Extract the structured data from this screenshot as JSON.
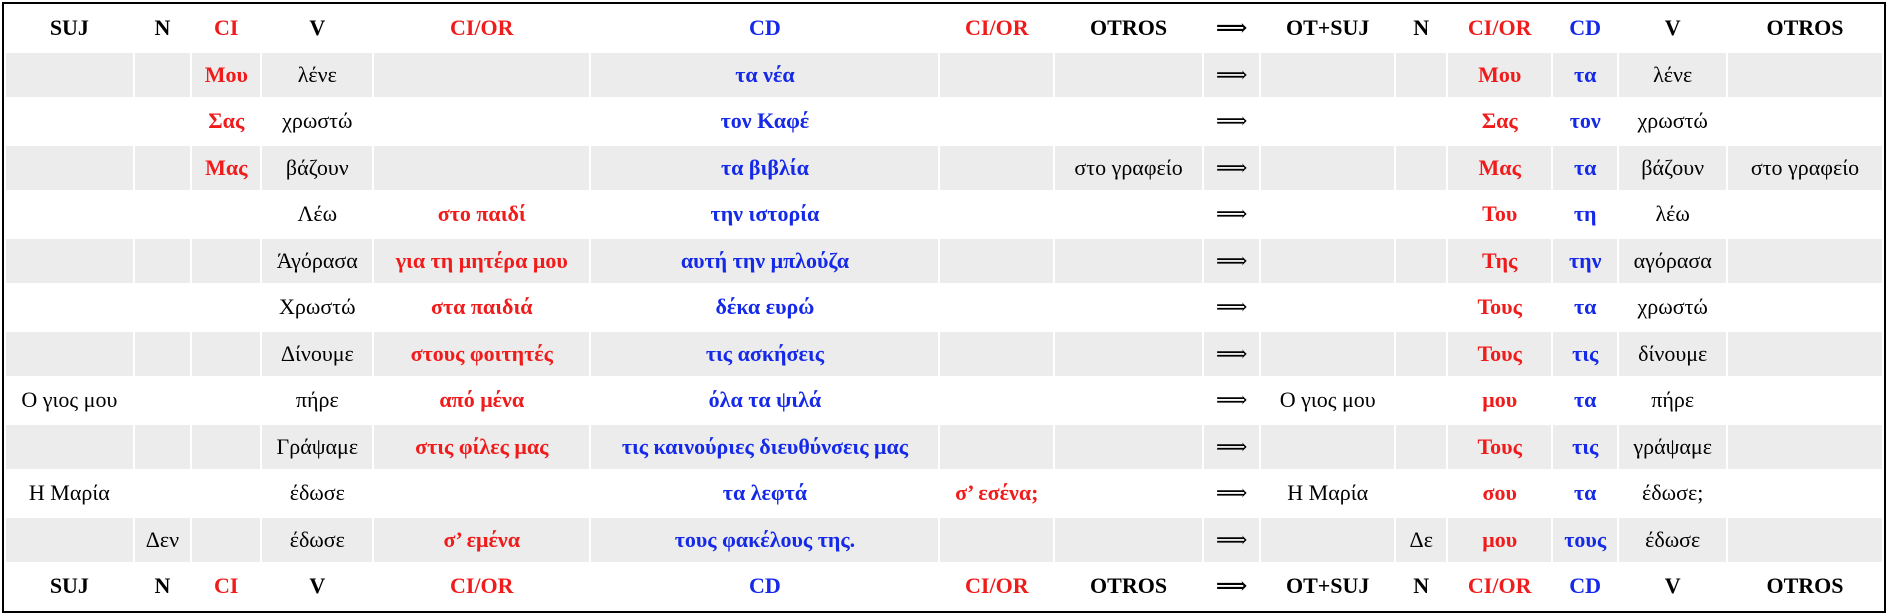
{
  "colors": {
    "red": "#f01c1c",
    "blue": "#1529e8",
    "shade": "#ececec"
  },
  "header": [
    "SUJ",
    "N",
    "CI",
    "V",
    "CI/OR",
    "CD",
    "CI/OR",
    "OTROS",
    "⟹",
    "OT+SUJ",
    "N",
    "CI/OR",
    "CD",
    "V",
    "OTROS"
  ],
  "rows": [
    [
      "",
      "",
      "Μου",
      "λένε",
      "",
      "τα νέα",
      "",
      "",
      "⟹",
      "",
      "",
      "Μου",
      "τα",
      "λένε",
      ""
    ],
    [
      "",
      "",
      "Σας",
      "χρωστώ",
      "",
      "τον Καφέ",
      "",
      "",
      "⟹",
      "",
      "",
      "Σας",
      "τον",
      "χρωστώ",
      ""
    ],
    [
      "",
      "",
      "Μας",
      "βάζουν",
      "",
      "τα βιβλία",
      "",
      "στο γραφείο",
      "⟹",
      "",
      "",
      "Μας",
      "τα",
      "βάζουν",
      "στο γραφείο"
    ],
    [
      "",
      "",
      "",
      "Λέω",
      "στο παιδί",
      "την ιστορία",
      "",
      "",
      "⟹",
      "",
      "",
      "Του",
      "τη",
      "λέω",
      ""
    ],
    [
      "",
      "",
      "",
      "Άγόρασα",
      "για τη μητέρα μου",
      "αυτή την μπλούζα",
      "",
      "",
      "⟹",
      "",
      "",
      "Της",
      "την",
      "αγόρασα",
      ""
    ],
    [
      "",
      "",
      "",
      "Χρωστώ",
      "στα παιδιά",
      "δέκα ευρώ",
      "",
      "",
      "⟹",
      "",
      "",
      "Τους",
      "τα",
      "χρωστώ",
      ""
    ],
    [
      "",
      "",
      "",
      "Δίνουμε",
      "στους φοιτητές",
      "τις ασκήσεις",
      "",
      "",
      "⟹",
      "",
      "",
      "Τους",
      "τις",
      "δίνουμε",
      ""
    ],
    [
      "Ο γιος μου",
      "",
      "",
      "πήρε",
      "από μένα",
      "όλα τα ψιλά",
      "",
      "",
      "⟹",
      "Ο γιος μου",
      "",
      "μου",
      "τα",
      "πήρε",
      ""
    ],
    [
      "",
      "",
      "",
      "Γράψαμε",
      "στις φίλες μας",
      "τις καινούριες διευθύνσεις μας",
      "",
      "",
      "⟹",
      "",
      "",
      "Τους",
      "τις",
      "γράψαμε",
      ""
    ],
    [
      "Η Μαρία",
      "",
      "",
      "έδωσε",
      "",
      "τα λεφτά",
      "σ’ εσένα;",
      "",
      "⟹",
      "Η Μαρία",
      "",
      "σου",
      "τα",
      "έδωσε;",
      ""
    ],
    [
      "",
      "Δεν",
      "",
      "έδωσε",
      "σ’ εμένα",
      "τους φακέλους της.",
      "",
      "",
      "⟹",
      "",
      "Δε",
      "μου",
      "τους",
      "έδωσε",
      ""
    ]
  ],
  "footer": [
    "SUJ",
    "N",
    "CI",
    "V",
    "CI/OR",
    "CD",
    "CI/OR",
    "OTROS",
    "⟹",
    "OT+SUJ",
    "N",
    "CI/OR",
    "CD",
    "V",
    "OTROS"
  ]
}
